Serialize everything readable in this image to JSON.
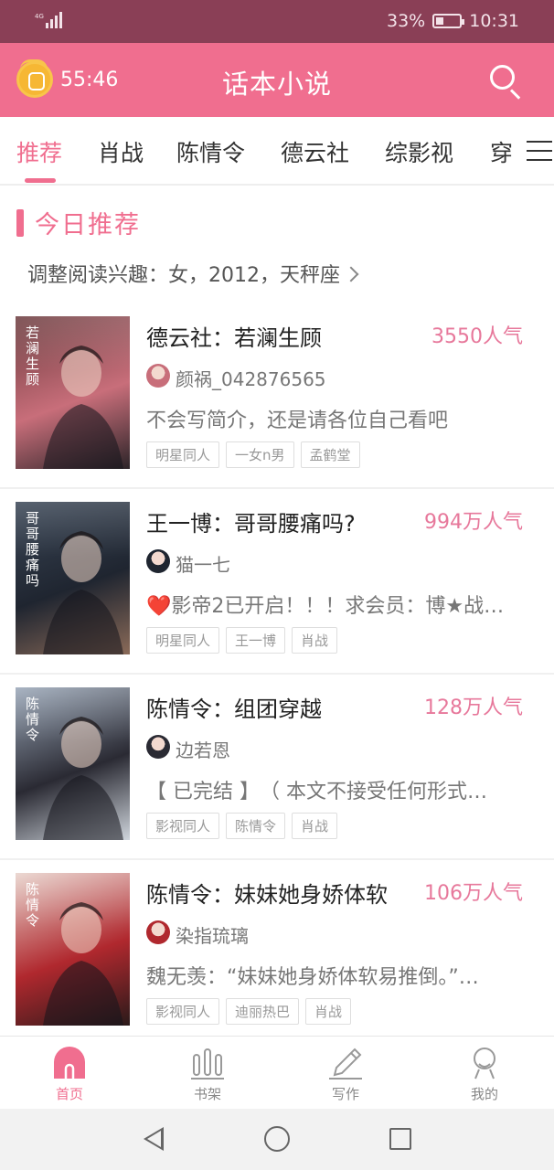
{
  "status_bar": {
    "network": "4G",
    "battery_percent": "33%",
    "battery_level": 0.33,
    "time": "10:31"
  },
  "header": {
    "timer": "55:46",
    "title": "话本小说"
  },
  "tabs": [
    {
      "label": "推荐",
      "active": true
    },
    {
      "label": "肖战"
    },
    {
      "label": "陈情令"
    },
    {
      "label": "德云社"
    },
    {
      "label": "综影视"
    },
    {
      "label": "穿"
    }
  ],
  "section": {
    "title": "今日推荐",
    "interest_prefs": "调整阅读兴趣：女，2012，天秤座"
  },
  "books": [
    {
      "title": "德云社：若澜生顾",
      "popularity": "3550人气",
      "author": "颜祸_042876565",
      "description": "不会写简介，还是请各位自己看吧",
      "tags": [
        "明星同人",
        "一女n男",
        "孟鹤堂"
      ],
      "cover_text": "若澜生顾",
      "cover_colors": [
        "#6b3b3e",
        "#c86e7a",
        "#2c2428"
      ]
    },
    {
      "title": "王一博：哥哥腰痛吗?",
      "popularity": "994万人气",
      "author": "猫一七",
      "description": "❤️影帝2已开启！！！求会员：博★战…",
      "tags": [
        "明星同人",
        "王一博",
        "肖战"
      ],
      "cover_text": "哥哥腰痛吗",
      "cover_colors": [
        "#3a4656",
        "#1f2530",
        "#8a6a58"
      ]
    },
    {
      "title": "陈情令：组团穿越",
      "popularity": "128万人气",
      "author": "边若恩",
      "description": "【 已完结 】　（ 本文不接受任何形式…",
      "tags": [
        "影视同人",
        "陈情令",
        "肖战"
      ],
      "cover_text": "陈情令",
      "cover_colors": [
        "#9aa7b8",
        "#2a2a33",
        "#cfd5dc"
      ]
    },
    {
      "title": "陈情令：妹妹她身娇体软",
      "popularity": "106万人气",
      "author": "染指琉璃",
      "description": "魏无羡：“妹妹她身娇体软易推倒。”…",
      "tags": [
        "影视同人",
        "迪丽热巴",
        "肖战"
      ],
      "cover_text": "陈情令",
      "cover_colors": [
        "#e8d2cb",
        "#b0282e",
        "#2a1a1a"
      ]
    }
  ],
  "bottom_nav": [
    {
      "label": "首页",
      "active": true,
      "icon": "home-icon"
    },
    {
      "label": "书架",
      "icon": "bookshelf-icon"
    },
    {
      "label": "写作",
      "icon": "pencil-icon"
    },
    {
      "label": "我的",
      "icon": "profile-icon"
    }
  ],
  "colors": {
    "accent": "#f06e8f",
    "status_bar": "#8a3f56",
    "popularity": "#e7789b"
  }
}
